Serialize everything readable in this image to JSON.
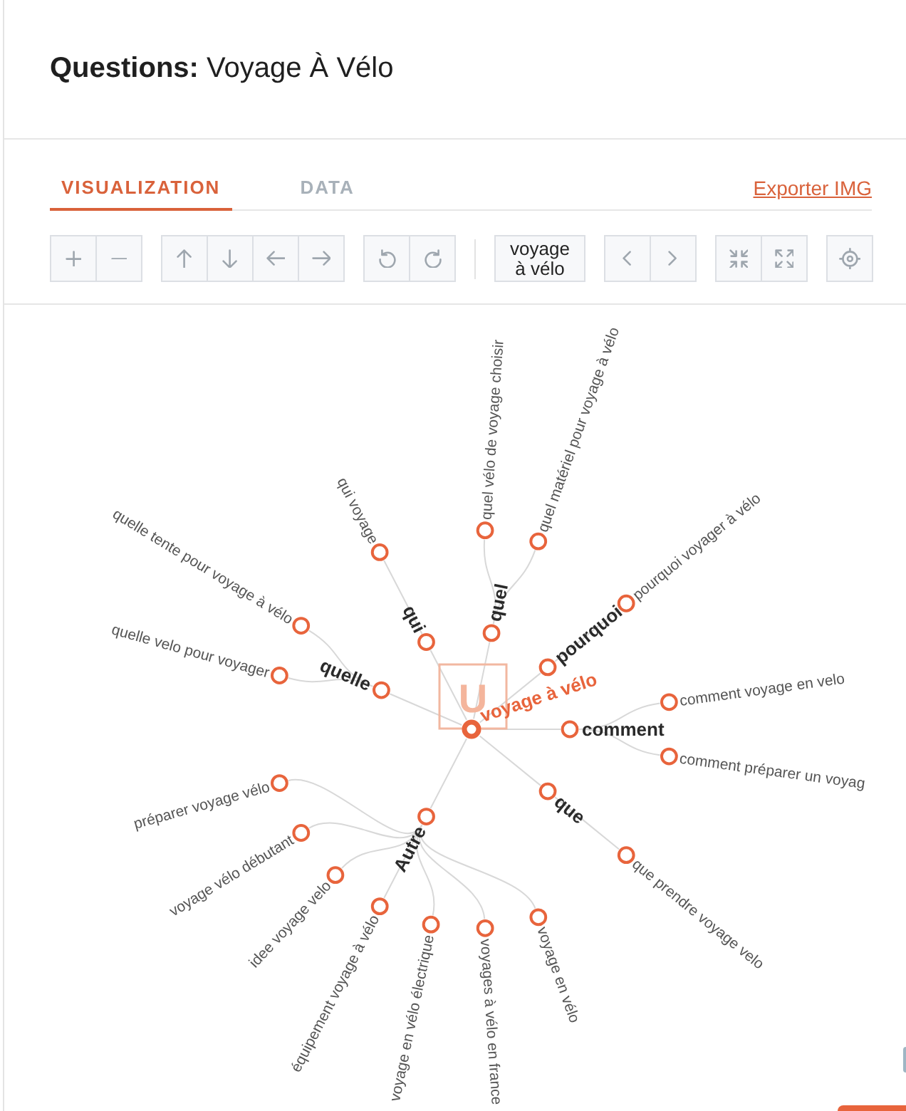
{
  "header": {
    "title": "**Questions:** Voyage À Vélo"
  },
  "tabs": [
    {
      "label": "VISUALIZATION",
      "selected": true
    },
    {
      "label": "DATA",
      "selected": false
    }
  ],
  "export_link": "Exporter IMG",
  "toolbar": [
    {
      "divider_before": false,
      "buttons": [
        {
          "kind": "zoom_in"
        },
        {
          "kind": "zoom_out"
        }
      ]
    },
    {
      "divider_before": false,
      "buttons": [
        {
          "kind": "up"
        },
        {
          "kind": "down"
        },
        {
          "kind": "left"
        },
        {
          "kind": "right"
        }
      ]
    },
    {
      "divider_before": false,
      "buttons": [
        {
          "kind": "undo"
        },
        {
          "kind": "redo"
        }
      ]
    },
    {
      "divider_before": true,
      "buttons": [
        {
          "kind": "text",
          "label": "voyage à vélo"
        }
      ]
    },
    {
      "divider_before": false,
      "buttons": [
        {
          "kind": "prev"
        },
        {
          "kind": "next"
        }
      ]
    },
    {
      "divider_before": false,
      "buttons": [
        {
          "kind": "collapse"
        },
        {
          "kind": "expand"
        }
      ]
    },
    {
      "divider_before": false,
      "buttons": [
        {
          "kind": "center"
        }
      ]
    }
  ],
  "mind_map": {
    "root": {
      "label": "voyage à vélo",
      "badge": "U",
      "children": [
        {
          "label": "qui",
          "children": [
            {
              "label": "qui voyage"
            }
          ]
        },
        {
          "label": "quel",
          "children": [
            {
              "label": "quel vélo de voyage choisir"
            },
            {
              "label": "quel matériel pour voyage à vélo"
            }
          ]
        },
        {
          "label": "pourquoi",
          "children": [
            {
              "label": "pourquoi voyager à vélo"
            }
          ]
        },
        {
          "label": "comment",
          "children": [
            {
              "label": "comment voyage en velo"
            },
            {
              "label": "comment préparer un voyag"
            }
          ]
        },
        {
          "label": "que",
          "children": [
            {
              "label": "que prendre voyage velo"
            }
          ]
        },
        {
          "label": "Autre",
          "children": [
            {
              "label": "voyage en vélo"
            },
            {
              "label": "voyages à vélo en france"
            },
            {
              "label": "voyage en vélo électrique"
            },
            {
              "label": "équipement voyage à vélo"
            },
            {
              "label": "idee voyage velo"
            },
            {
              "label": "voyage vélo débutant"
            },
            {
              "label": "préparer voyage vélo"
            }
          ]
        },
        {
          "label": "quelle",
          "children": [
            {
              "label": "quelle velo pour voyager"
            },
            {
              "label": "quelle tente pour voyage à vélo"
            }
          ]
        }
      ]
    }
  }
}
